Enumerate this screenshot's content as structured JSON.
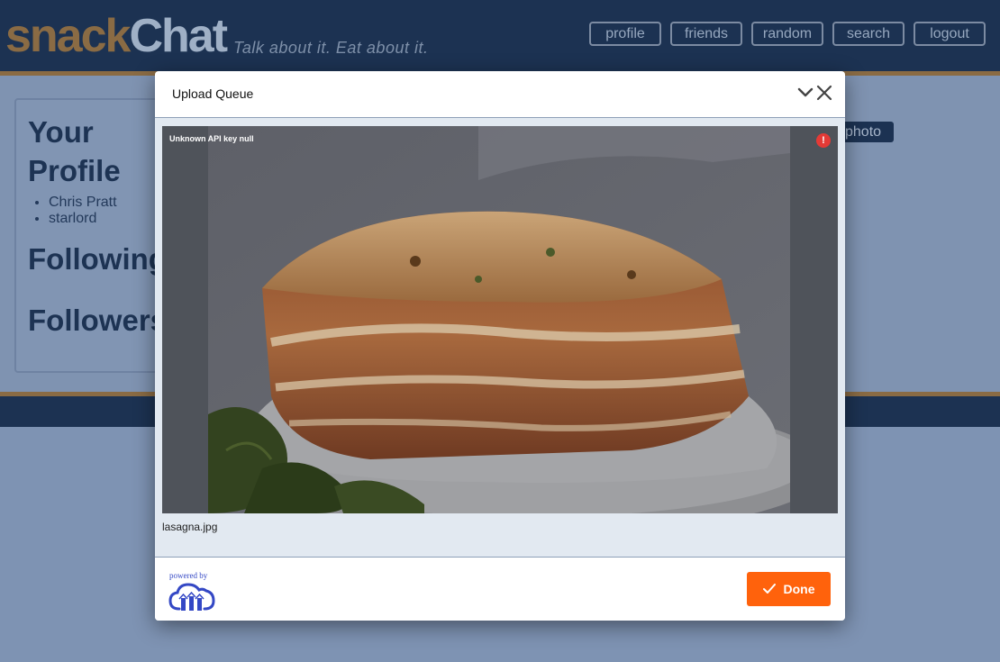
{
  "app": {
    "logo_part1": "snack",
    "logo_part2": "Chat",
    "tagline": "Talk about it. Eat about it.",
    "nav": [
      "profile",
      "friends",
      "random",
      "search",
      "logout"
    ]
  },
  "profile": {
    "title": "Your Profile",
    "details": [
      "Chris Pratt",
      "starlord"
    ],
    "following_title": "Following",
    "followers_title": "Followers"
  },
  "photo_button": "photo",
  "modal": {
    "title": "Upload Queue",
    "error": "Unknown API key null",
    "file_name": "lasagna.jpg",
    "powered_by": "powered by",
    "done_label": "Done"
  },
  "colors": {
    "header_bg": "#1c3252",
    "accent_brown": "#8a6b44",
    "done_orange": "#ff620c",
    "error_red": "#e53a36",
    "cloudinary_blue": "#3448c5"
  },
  "icons": [
    "chevron-down-icon",
    "close-icon",
    "error-icon",
    "check-icon",
    "cloudinary-logo-icon"
  ]
}
